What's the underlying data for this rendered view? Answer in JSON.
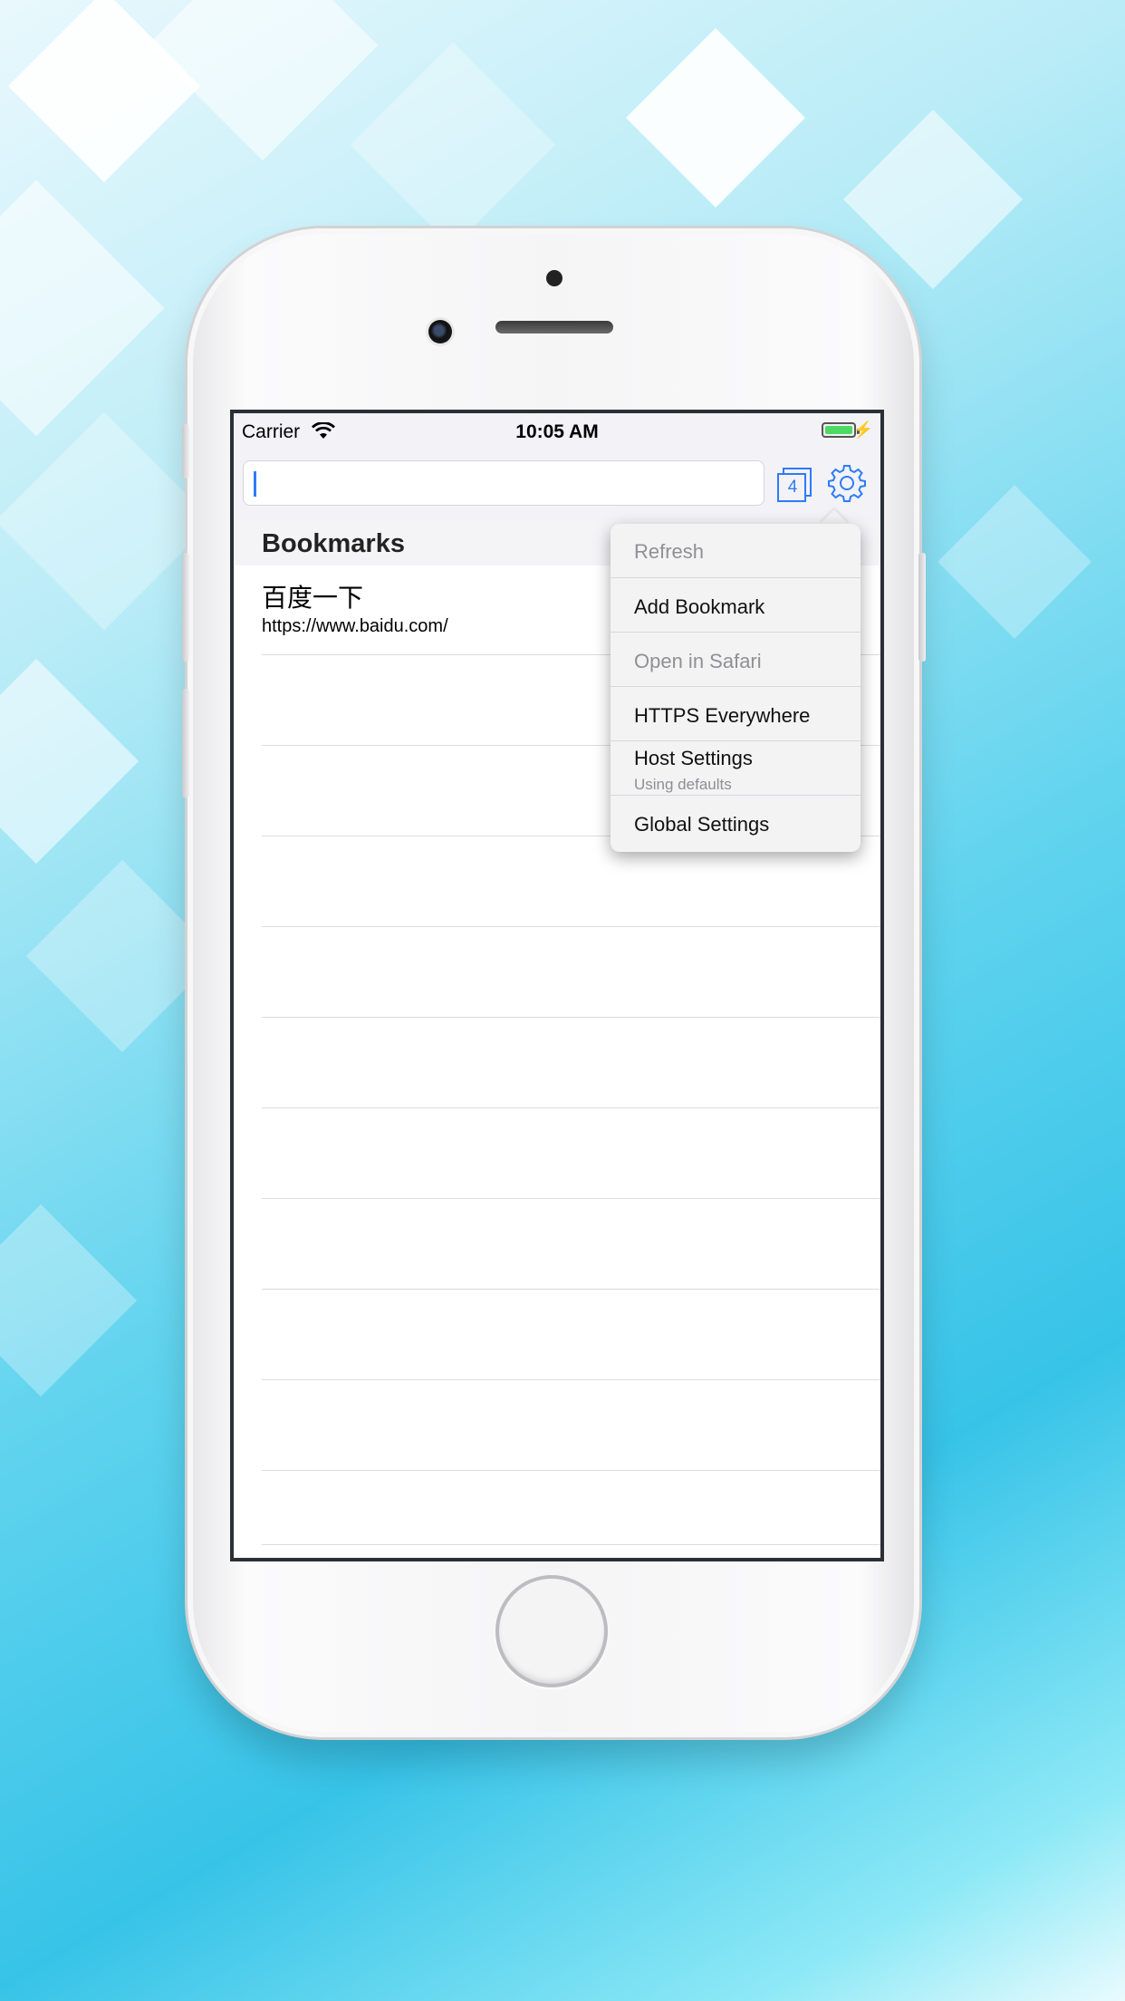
{
  "status_bar": {
    "carrier": "Carrier",
    "time": "10:05 AM"
  },
  "toolbar": {
    "url_placeholder": "",
    "tab_count": "4"
  },
  "bookmarks": {
    "header": "Bookmarks",
    "items": [
      {
        "title": "百度一下",
        "url": "https://www.baidu.com/"
      }
    ]
  },
  "menu": {
    "items": [
      {
        "label": "Refresh",
        "enabled": false
      },
      {
        "label": "Add Bookmark",
        "enabled": true
      },
      {
        "label": "Open in Safari",
        "enabled": false
      },
      {
        "label": "HTTPS Everywhere",
        "enabled": true
      },
      {
        "label": "Host Settings",
        "sublabel": "Using defaults",
        "enabled": true
      },
      {
        "label": "Global Settings",
        "enabled": true
      }
    ]
  },
  "colors": {
    "accent": "#2f7bf6",
    "battery": "#4cd964"
  }
}
